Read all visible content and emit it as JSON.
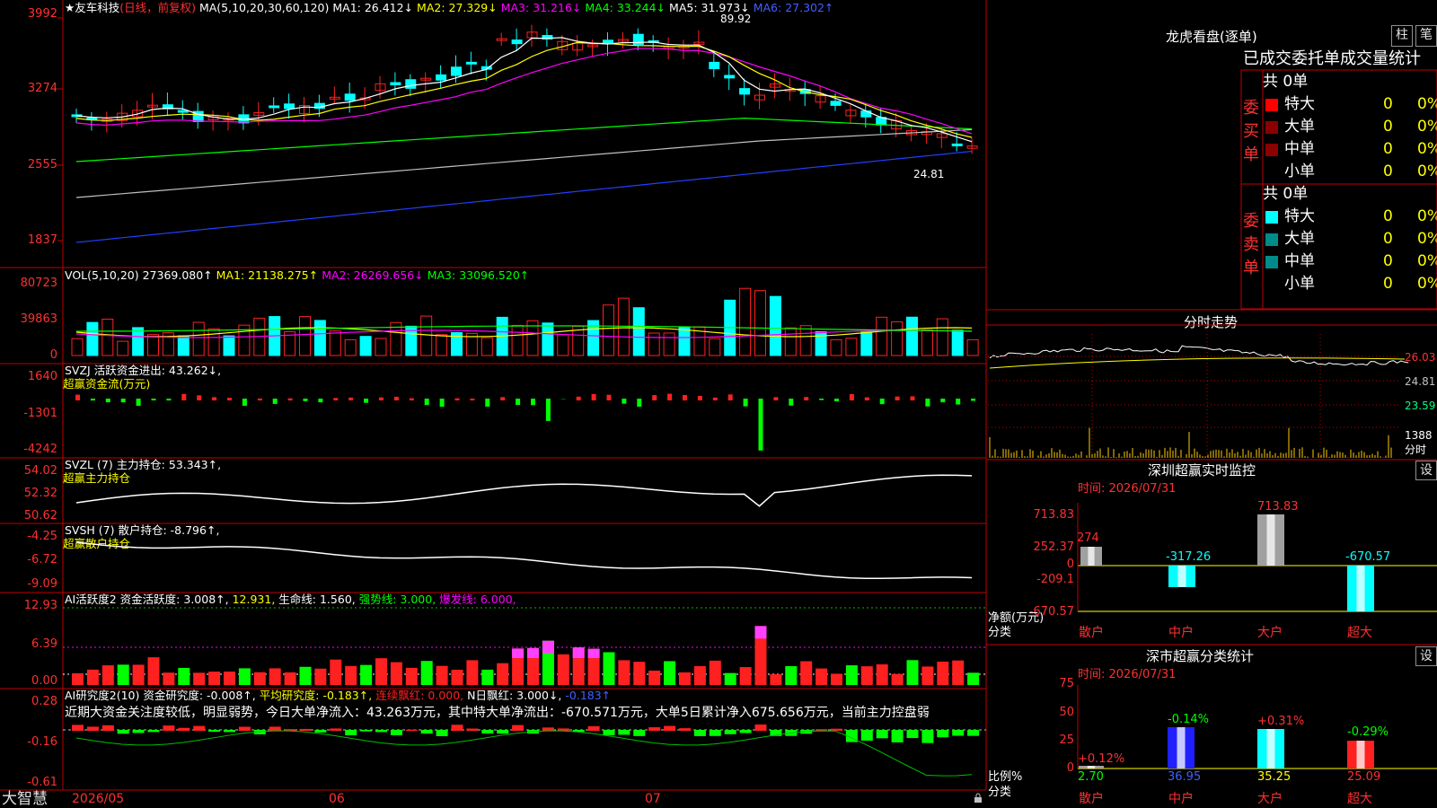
{
  "app": {
    "brand": "大智慧"
  },
  "main_chart": {
    "header": {
      "stock": "★友车科技",
      "mode": "(日线，前复权)",
      "ma_params": "MA(5,10,20,30,60,120)",
      "ma1": "MA1: 26.412↓",
      "ma2": "MA2: 27.329↓",
      "ma3": "MA3: 31.216↓",
      "ma4": "MA4: 33.244↓",
      "ma5": "MA5: 31.973↓",
      "ma6": "MA6: 27.302↑"
    },
    "y_labels": [
      "3992",
      "3274",
      "2555",
      "1837"
    ],
    "high_label": "89.92",
    "low_label": "24.81",
    "colors": {
      "ma1": "#ffffff",
      "ma2": "#ffff00",
      "ma3": "#ff00ff",
      "ma4": "#00ff00",
      "ma5": "#c0c0c0",
      "ma6": "#2040ff",
      "up": "#ff2020",
      "down": "#00ffff"
    }
  },
  "vol_panel": {
    "header": {
      "name": "VOL(5,10,20)",
      "val": "27369.080↑",
      "ma1": "MA1: 21138.275↑",
      "ma2": "MA2: 26269.656↓",
      "ma3": "MA3: 33096.520↑"
    },
    "y_labels": [
      "80723",
      "39863",
      "0"
    ]
  },
  "svzj_panel": {
    "header": {
      "name": "SVZJ  活跃资金进出:",
      "val": "43.262↓,",
      "sub": "超赢资金流(万元)"
    },
    "y_labels": [
      "1640",
      "-1301",
      "-4242"
    ]
  },
  "svzl_panel": {
    "header": {
      "name": "SVZL (7) 主力持仓:",
      "val": "53.343↑,",
      "sub": "超赢主力持仓"
    },
    "y_labels": [
      "54.02",
      "52.32",
      "50.62"
    ]
  },
  "svsh_panel": {
    "header": {
      "name": "SVSH (7) 散户持仓:",
      "val": "-8.796↑,",
      "sub": "超赢散户持仓"
    },
    "y_labels": [
      "-4.25",
      "-6.72",
      "-9.09"
    ]
  },
  "ai_active_panel": {
    "header": {
      "name": "AI活跃度2 资金活跃度:",
      "val": "3.008↑,",
      "v2": "12.931,",
      "life": "生命线: 1.560,",
      "strong": "强势线: 3.000,",
      "burst": "爆发线: 6.000,"
    },
    "y_labels": [
      "12.93",
      "6.39",
      "0.00"
    ]
  },
  "ai_research_panel": {
    "header": {
      "name": "AI研究度2(10) 资金研究度:",
      "val": "-0.008↑,",
      "avg": "平均研究度: -0.183↑,",
      "red": "连续飘红: 0.000,",
      "nred": "N日飘红: 3.000↓,",
      "last": "-0.183↑"
    },
    "summary": "近期大资金关注度较低，明显弱势，今日大单净流入：43.263万元，其中特大单净流出：-670.571万元，大单5日累计净入675.656万元，当前主力控盘弱",
    "y_labels": [
      "0.28",
      "-0.16",
      "-0.61"
    ]
  },
  "x_axis": {
    "labels": [
      "2026/05",
      "06",
      "07"
    ]
  },
  "dragon_tiger": {
    "title": "龙虎看盘(逐单)",
    "tab1": "柱",
    "tab2": "笔",
    "tabs_header": "已成交委托单成交量统计",
    "buy": {
      "side_label": "委买单",
      "total": "共 0单",
      "rows": [
        {
          "name": "特大",
          "count": "0",
          "pct": "0%",
          "color": "#ff0000"
        },
        {
          "name": "大单",
          "count": "0",
          "pct": "0%",
          "color": "#8b0000"
        },
        {
          "name": "中单",
          "count": "0",
          "pct": "0%",
          "color": "#8b0000"
        },
        {
          "name": "小单",
          "count": "0",
          "pct": "0%",
          "color": "#000000"
        }
      ]
    },
    "sell": {
      "side_label": "委卖单",
      "total": "共 0单",
      "rows": [
        {
          "name": "特大",
          "count": "0",
          "pct": "0%",
          "color": "#00ffff"
        },
        {
          "name": "大单",
          "count": "0",
          "pct": "0%",
          "color": "#008b8b"
        },
        {
          "name": "中单",
          "count": "0",
          "pct": "0%",
          "color": "#008b8b"
        },
        {
          "name": "小单",
          "count": "0",
          "pct": "0%",
          "color": "#000000"
        }
      ]
    }
  },
  "intraday": {
    "title": "分时走势",
    "y_labels": [
      "26.03",
      "24.81",
      "23.59",
      "1388",
      "分时"
    ]
  },
  "monitor": {
    "title": "深圳超赢实时监控",
    "settings": "设",
    "time": "时间: 2026/07/31",
    "y_labels": [
      "713.83",
      "252.37",
      "0",
      "-209.1",
      "-670.57"
    ],
    "axis_title1": "净额(万元)",
    "axis_title2": "分类",
    "bars": [
      {
        "name": "散户",
        "value": "274"
      },
      {
        "name": "中户",
        "value": "-317.26"
      },
      {
        "name": "大户",
        "value": "713.83"
      },
      {
        "name": "超大",
        "value": "-670.57"
      }
    ]
  },
  "classify": {
    "title": "深市超赢分类统计",
    "settings": "设",
    "time": "时间: 2026/07/31",
    "y_labels": [
      "75",
      "50",
      "25",
      "0"
    ],
    "axis_title1": "比例%",
    "axis_title2": "分类",
    "bars": [
      {
        "name": "散户",
        "value": "2.70",
        "change": "+0.12%"
      },
      {
        "name": "中户",
        "value": "36.95",
        "change": "-0.14%"
      },
      {
        "name": "大户",
        "value": "35.25",
        "change": "+0.31%"
      },
      {
        "name": "超大",
        "value": "25.09",
        "change": "-0.29%"
      }
    ]
  }
}
